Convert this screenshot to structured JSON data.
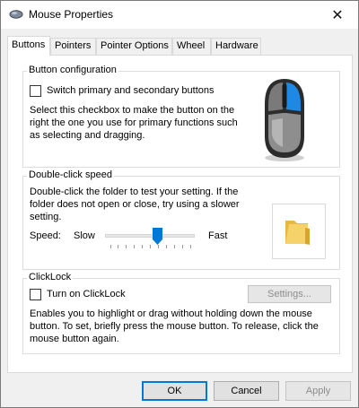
{
  "window": {
    "title": "Mouse Properties",
    "app_icon": "mouse-icon",
    "close_icon": "close-icon",
    "close_glyph": "✕"
  },
  "tabs": [
    {
      "label": "Buttons",
      "active": true
    },
    {
      "label": "Pointers",
      "active": false
    },
    {
      "label": "Pointer Options",
      "active": false
    },
    {
      "label": "Wheel",
      "active": false
    },
    {
      "label": "Hardware",
      "active": false
    }
  ],
  "button_config": {
    "title": "Button configuration",
    "checkbox_label": "Switch primary and secondary buttons",
    "checked": false,
    "description": "Select this checkbox to make the button on the right the one you use for primary functions such as selecting and dragging.",
    "image_icon": "mouse-image-icon",
    "colors": {
      "body": "#555555",
      "highlight": "#1e88e5"
    }
  },
  "double_click": {
    "title": "Double-click speed",
    "description": "Double-click the folder to test your setting. If the folder does not open or close, try using a slower setting.",
    "speed_label": "Speed:",
    "slow_label": "Slow",
    "fast_label": "Fast",
    "speed_level": 0.59,
    "tick_count": 11,
    "test_icon": "folder-icon",
    "colors": {
      "thumb": "#0078d7",
      "folder": "#f5d36a"
    }
  },
  "clicklock": {
    "title": "ClickLock",
    "checkbox_label": "Turn on ClickLock",
    "checked": false,
    "settings_label": "Settings...",
    "settings_enabled": false,
    "description": "Enables you to highlight or drag without holding down the mouse button. To set, briefly press the mouse button. To release, click the mouse button again."
  },
  "footer": {
    "ok_label": "OK",
    "cancel_label": "Cancel",
    "apply_label": "Apply",
    "apply_enabled": false
  },
  "colors": {
    "accent": "#0078d7",
    "window_bg": "#f0f0f0"
  }
}
